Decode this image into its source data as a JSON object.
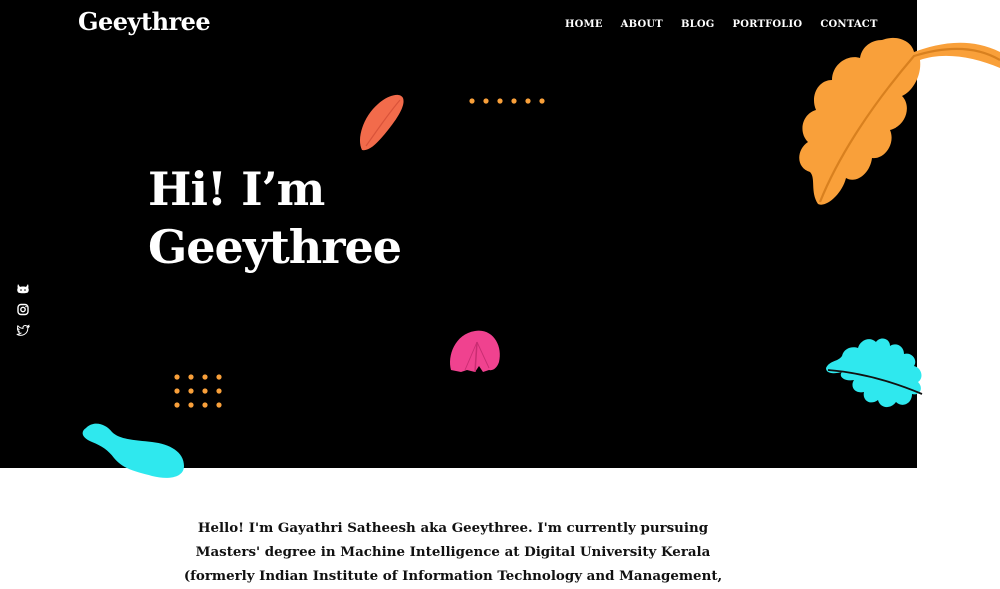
{
  "site": {
    "logo": "Geeythree"
  },
  "nav": {
    "items": [
      {
        "label": "HOME"
      },
      {
        "label": "ABOUT"
      },
      {
        "label": "BLOG"
      },
      {
        "label": "PORTFOLIO"
      },
      {
        "label": "CONTACT"
      }
    ]
  },
  "hero": {
    "line1": "Hi! I’m",
    "line2": "Geeythree"
  },
  "social": {
    "icons": [
      "github-icon",
      "instagram-icon",
      "twitter-icon"
    ]
  },
  "about": {
    "text": "Hello! I'm Gayathri Satheesh aka Geeythree. I'm currently pursuing Masters' degree in Machine Intelligence at Digital University Kerala (formerly Indian Institute of Information Technology and Management, Kerala)."
  },
  "colors": {
    "hero_background": "#000000",
    "page_background": "#ffffff",
    "text_light": "#ffffff",
    "text_dark": "#111111",
    "orange": "#f9a03a",
    "coral": "#f26b4b",
    "pink": "#f0428f",
    "cyan": "#2fe8ee"
  }
}
